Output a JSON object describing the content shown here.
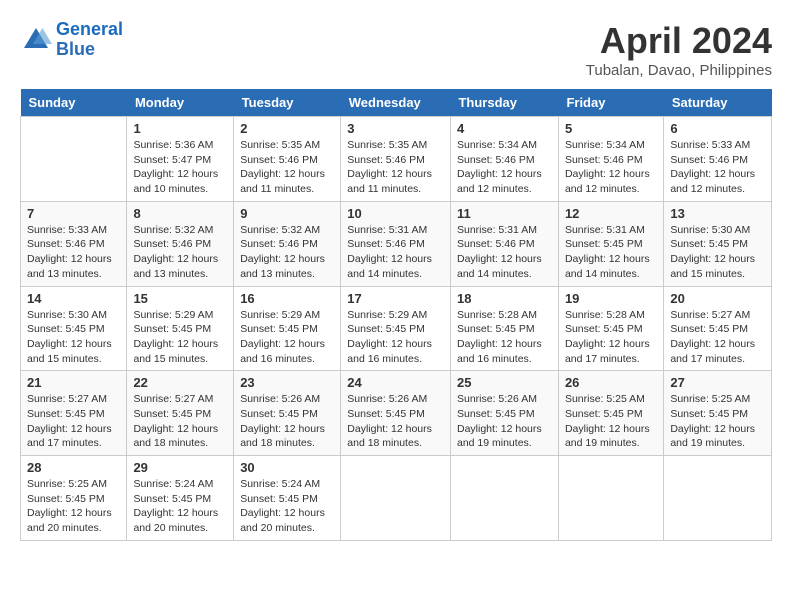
{
  "header": {
    "logo_line1": "General",
    "logo_line2": "Blue",
    "month": "April 2024",
    "location": "Tubalan, Davao, Philippines"
  },
  "days_of_week": [
    "Sunday",
    "Monday",
    "Tuesday",
    "Wednesday",
    "Thursday",
    "Friday",
    "Saturday"
  ],
  "weeks": [
    [
      {
        "day": "",
        "info": ""
      },
      {
        "day": "1",
        "info": "Sunrise: 5:36 AM\nSunset: 5:47 PM\nDaylight: 12 hours\nand 10 minutes."
      },
      {
        "day": "2",
        "info": "Sunrise: 5:35 AM\nSunset: 5:46 PM\nDaylight: 12 hours\nand 11 minutes."
      },
      {
        "day": "3",
        "info": "Sunrise: 5:35 AM\nSunset: 5:46 PM\nDaylight: 12 hours\nand 11 minutes."
      },
      {
        "day": "4",
        "info": "Sunrise: 5:34 AM\nSunset: 5:46 PM\nDaylight: 12 hours\nand 12 minutes."
      },
      {
        "day": "5",
        "info": "Sunrise: 5:34 AM\nSunset: 5:46 PM\nDaylight: 12 hours\nand 12 minutes."
      },
      {
        "day": "6",
        "info": "Sunrise: 5:33 AM\nSunset: 5:46 PM\nDaylight: 12 hours\nand 12 minutes."
      }
    ],
    [
      {
        "day": "7",
        "info": "Sunrise: 5:33 AM\nSunset: 5:46 PM\nDaylight: 12 hours\nand 13 minutes."
      },
      {
        "day": "8",
        "info": "Sunrise: 5:32 AM\nSunset: 5:46 PM\nDaylight: 12 hours\nand 13 minutes."
      },
      {
        "day": "9",
        "info": "Sunrise: 5:32 AM\nSunset: 5:46 PM\nDaylight: 12 hours\nand 13 minutes."
      },
      {
        "day": "10",
        "info": "Sunrise: 5:31 AM\nSunset: 5:46 PM\nDaylight: 12 hours\nand 14 minutes."
      },
      {
        "day": "11",
        "info": "Sunrise: 5:31 AM\nSunset: 5:46 PM\nDaylight: 12 hours\nand 14 minutes."
      },
      {
        "day": "12",
        "info": "Sunrise: 5:31 AM\nSunset: 5:45 PM\nDaylight: 12 hours\nand 14 minutes."
      },
      {
        "day": "13",
        "info": "Sunrise: 5:30 AM\nSunset: 5:45 PM\nDaylight: 12 hours\nand 15 minutes."
      }
    ],
    [
      {
        "day": "14",
        "info": "Sunrise: 5:30 AM\nSunset: 5:45 PM\nDaylight: 12 hours\nand 15 minutes."
      },
      {
        "day": "15",
        "info": "Sunrise: 5:29 AM\nSunset: 5:45 PM\nDaylight: 12 hours\nand 15 minutes."
      },
      {
        "day": "16",
        "info": "Sunrise: 5:29 AM\nSunset: 5:45 PM\nDaylight: 12 hours\nand 16 minutes."
      },
      {
        "day": "17",
        "info": "Sunrise: 5:29 AM\nSunset: 5:45 PM\nDaylight: 12 hours\nand 16 minutes."
      },
      {
        "day": "18",
        "info": "Sunrise: 5:28 AM\nSunset: 5:45 PM\nDaylight: 12 hours\nand 16 minutes."
      },
      {
        "day": "19",
        "info": "Sunrise: 5:28 AM\nSunset: 5:45 PM\nDaylight: 12 hours\nand 17 minutes."
      },
      {
        "day": "20",
        "info": "Sunrise: 5:27 AM\nSunset: 5:45 PM\nDaylight: 12 hours\nand 17 minutes."
      }
    ],
    [
      {
        "day": "21",
        "info": "Sunrise: 5:27 AM\nSunset: 5:45 PM\nDaylight: 12 hours\nand 17 minutes."
      },
      {
        "day": "22",
        "info": "Sunrise: 5:27 AM\nSunset: 5:45 PM\nDaylight: 12 hours\nand 18 minutes."
      },
      {
        "day": "23",
        "info": "Sunrise: 5:26 AM\nSunset: 5:45 PM\nDaylight: 12 hours\nand 18 minutes."
      },
      {
        "day": "24",
        "info": "Sunrise: 5:26 AM\nSunset: 5:45 PM\nDaylight: 12 hours\nand 18 minutes."
      },
      {
        "day": "25",
        "info": "Sunrise: 5:26 AM\nSunset: 5:45 PM\nDaylight: 12 hours\nand 19 minutes."
      },
      {
        "day": "26",
        "info": "Sunrise: 5:25 AM\nSunset: 5:45 PM\nDaylight: 12 hours\nand 19 minutes."
      },
      {
        "day": "27",
        "info": "Sunrise: 5:25 AM\nSunset: 5:45 PM\nDaylight: 12 hours\nand 19 minutes."
      }
    ],
    [
      {
        "day": "28",
        "info": "Sunrise: 5:25 AM\nSunset: 5:45 PM\nDaylight: 12 hours\nand 20 minutes."
      },
      {
        "day": "29",
        "info": "Sunrise: 5:24 AM\nSunset: 5:45 PM\nDaylight: 12 hours\nand 20 minutes."
      },
      {
        "day": "30",
        "info": "Sunrise: 5:24 AM\nSunset: 5:45 PM\nDaylight: 12 hours\nand 20 minutes."
      },
      {
        "day": "",
        "info": ""
      },
      {
        "day": "",
        "info": ""
      },
      {
        "day": "",
        "info": ""
      },
      {
        "day": "",
        "info": ""
      }
    ]
  ]
}
